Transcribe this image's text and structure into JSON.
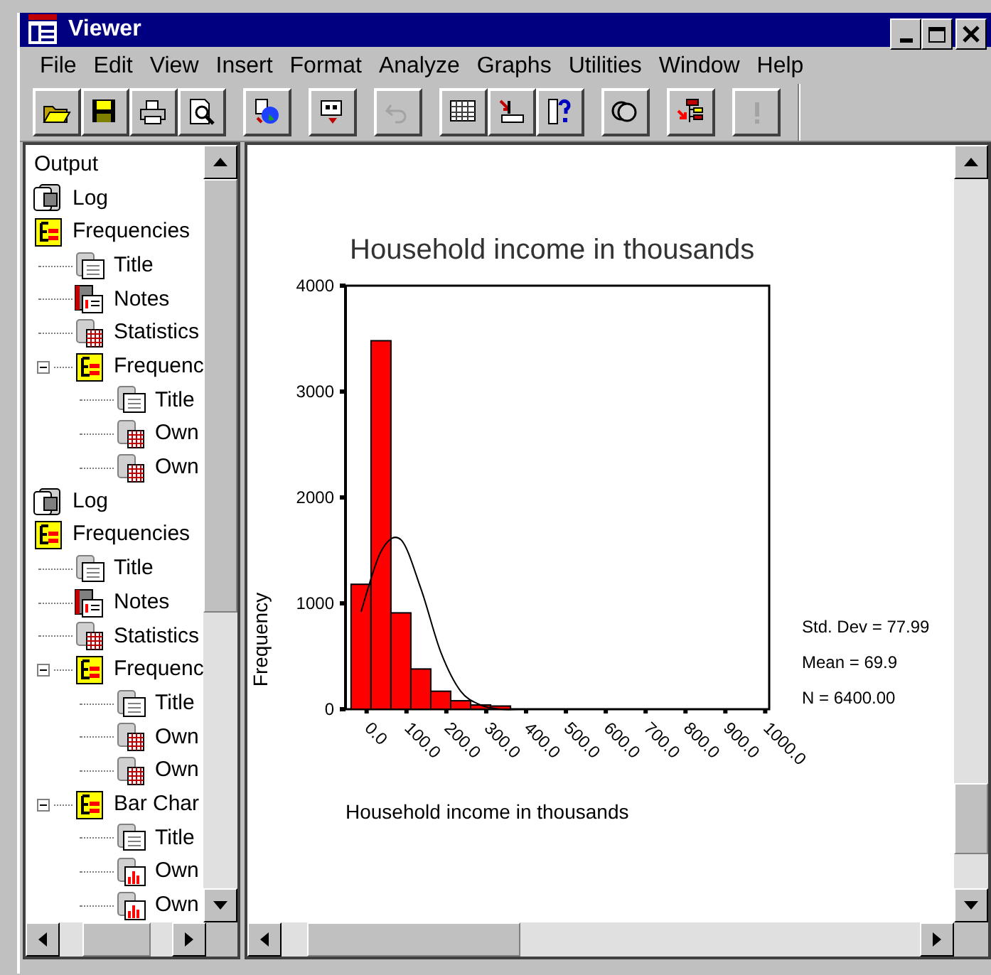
{
  "window": {
    "title": "Viewer"
  },
  "menu": [
    "File",
    "Edit",
    "View",
    "Insert",
    "Format",
    "Analyze",
    "Graphs",
    "Utilities",
    "Window",
    "Help"
  ],
  "toolbar": [
    {
      "kind": "open",
      "disabled": false
    },
    {
      "kind": "save",
      "disabled": false
    },
    {
      "kind": "print",
      "disabled": false
    },
    {
      "kind": "preview",
      "disabled": false
    },
    {
      "kind": "data",
      "disabled": false
    },
    {
      "kind": "export",
      "disabled": false
    },
    {
      "kind": "undo",
      "disabled": true
    },
    {
      "kind": "table",
      "disabled": false
    },
    {
      "kind": "insert",
      "disabled": false
    },
    {
      "kind": "help",
      "disabled": false
    },
    {
      "kind": "circles",
      "disabled": false
    },
    {
      "kind": "navigate",
      "disabled": false
    },
    {
      "kind": "run",
      "disabled": true
    }
  ],
  "outline": {
    "root": "Output",
    "items": [
      {
        "kind": "log",
        "label": "Log"
      },
      {
        "kind": "heading",
        "label": "Frequencies",
        "children": [
          {
            "kind": "title",
            "label": "Title"
          },
          {
            "kind": "notes",
            "label": "Notes"
          },
          {
            "kind": "table",
            "label": "Statistics"
          },
          {
            "kind": "heading",
            "label": "Frequenc",
            "children": [
              {
                "kind": "title",
                "label": "Title"
              },
              {
                "kind": "table",
                "label": "Own"
              },
              {
                "kind": "table",
                "label": "Own"
              }
            ]
          }
        ]
      },
      {
        "kind": "log",
        "label": "Log"
      },
      {
        "kind": "heading",
        "label": "Frequencies",
        "children": [
          {
            "kind": "title",
            "label": "Title"
          },
          {
            "kind": "notes",
            "label": "Notes"
          },
          {
            "kind": "table",
            "label": "Statistics"
          },
          {
            "kind": "heading",
            "label": "Frequenc",
            "children": [
              {
                "kind": "title",
                "label": "Title"
              },
              {
                "kind": "table",
                "label": "Own"
              },
              {
                "kind": "table",
                "label": "Own"
              }
            ]
          },
          {
            "kind": "heading",
            "label": "Bar Char",
            "children": [
              {
                "kind": "title",
                "label": "Title"
              },
              {
                "kind": "chart",
                "label": "Own"
              },
              {
                "kind": "chart",
                "label": "Own"
              }
            ]
          }
        ]
      }
    ]
  },
  "chart": {
    "chart_data": {
      "type": "bar",
      "title": "Household income in thousands",
      "xlabel": "Household income in thousands",
      "ylabel": "Frequency",
      "x": [
        -14,
        36,
        86,
        136,
        186,
        236,
        286,
        336,
        386,
        436,
        486,
        536
      ],
      "series": [
        {
          "color": "#ff0000",
          "values": [
            1180,
            3480,
            910,
            380,
            170,
            80,
            40,
            30,
            null,
            null,
            null,
            null
          ]
        },
        {
          "type": "line",
          "color": "#000000",
          "values": [
            920,
            1490,
            1600,
            1140,
            540,
            170,
            40,
            0,
            0,
            0,
            0,
            0
          ]
        }
      ],
      "xlim": [
        -53,
        1010
      ],
      "ylim": [
        0,
        4000
      ],
      "xticks": [
        {
          "value": 0,
          "label": "0.0"
        },
        {
          "value": 100,
          "label": "100.0"
        },
        {
          "value": 200,
          "label": "200.0"
        },
        {
          "value": 300,
          "label": "300.0"
        },
        {
          "value": 400,
          "label": "400.0"
        },
        {
          "value": 500,
          "label": "500.0"
        },
        {
          "value": 600,
          "label": "600.0"
        },
        {
          "value": 700,
          "label": "700.0"
        },
        {
          "value": 800,
          "label": "800.0"
        },
        {
          "value": 900,
          "label": "900.0"
        },
        {
          "value": 1000,
          "label": "1000.0"
        }
      ],
      "yticks": [
        {
          "value": 0,
          "label": "0"
        },
        {
          "value": 1000,
          "label": "1000"
        },
        {
          "value": 2000,
          "label": "2000"
        },
        {
          "value": 3000,
          "label": "3000"
        },
        {
          "value": 4000,
          "label": "4000"
        }
      ]
    },
    "stats": [
      "Std. Dev = 77.99",
      "Mean = 69.9",
      "N = 6400.00"
    ]
  }
}
